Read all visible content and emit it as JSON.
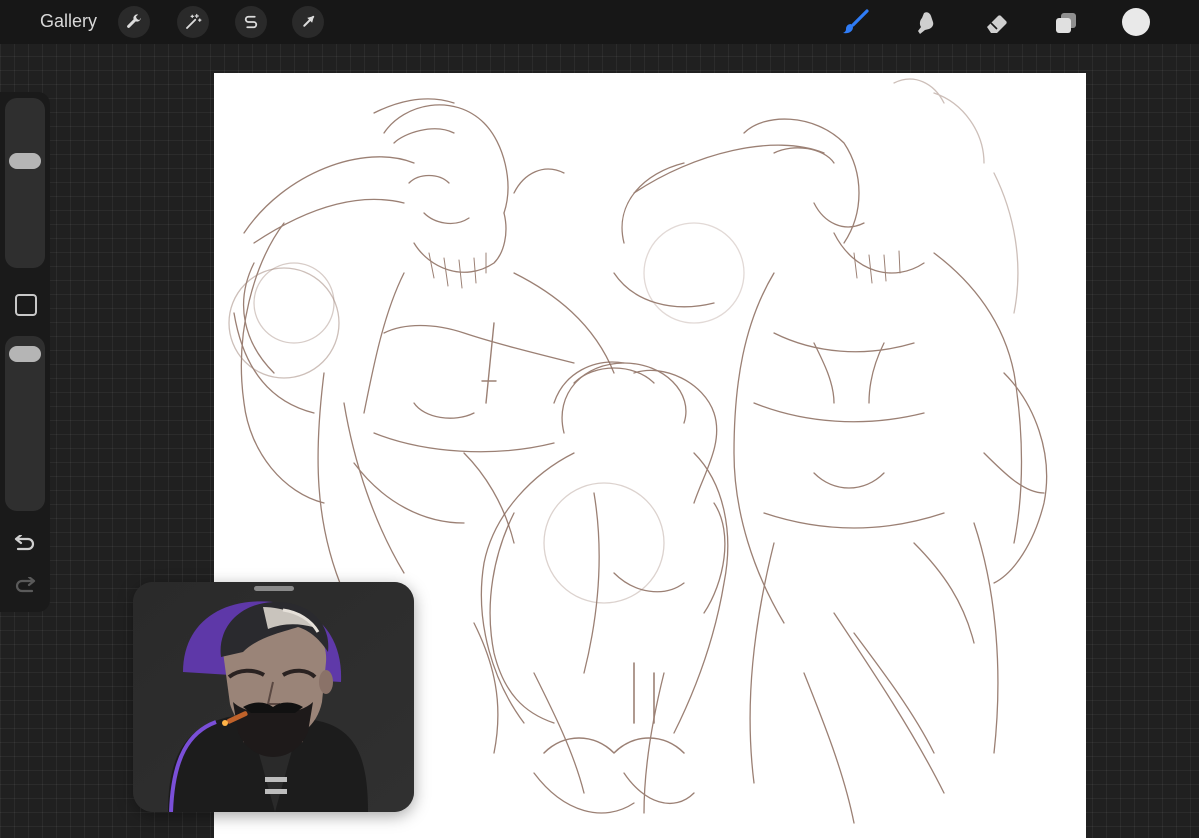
{
  "app": {
    "gallery_label": "Gallery"
  },
  "toolbar_left": [
    {
      "name": "actions-wrench-icon"
    },
    {
      "name": "adjustments-magic-wand-icon"
    },
    {
      "name": "selection-s-icon"
    },
    {
      "name": "transform-arrow-icon"
    }
  ],
  "toolbar_right": [
    {
      "name": "brush-icon",
      "active": true
    },
    {
      "name": "smudge-icon"
    },
    {
      "name": "eraser-icon"
    },
    {
      "name": "layers-icon"
    }
  ],
  "colors": {
    "accent": "#2f7cf6",
    "current_color": "#e9e9e9",
    "sketch_stroke": "#8a6a5c"
  },
  "sidebar": {
    "brush_size_level": 0.35,
    "opacity_level": 0.04
  },
  "reference": {
    "title": ""
  }
}
